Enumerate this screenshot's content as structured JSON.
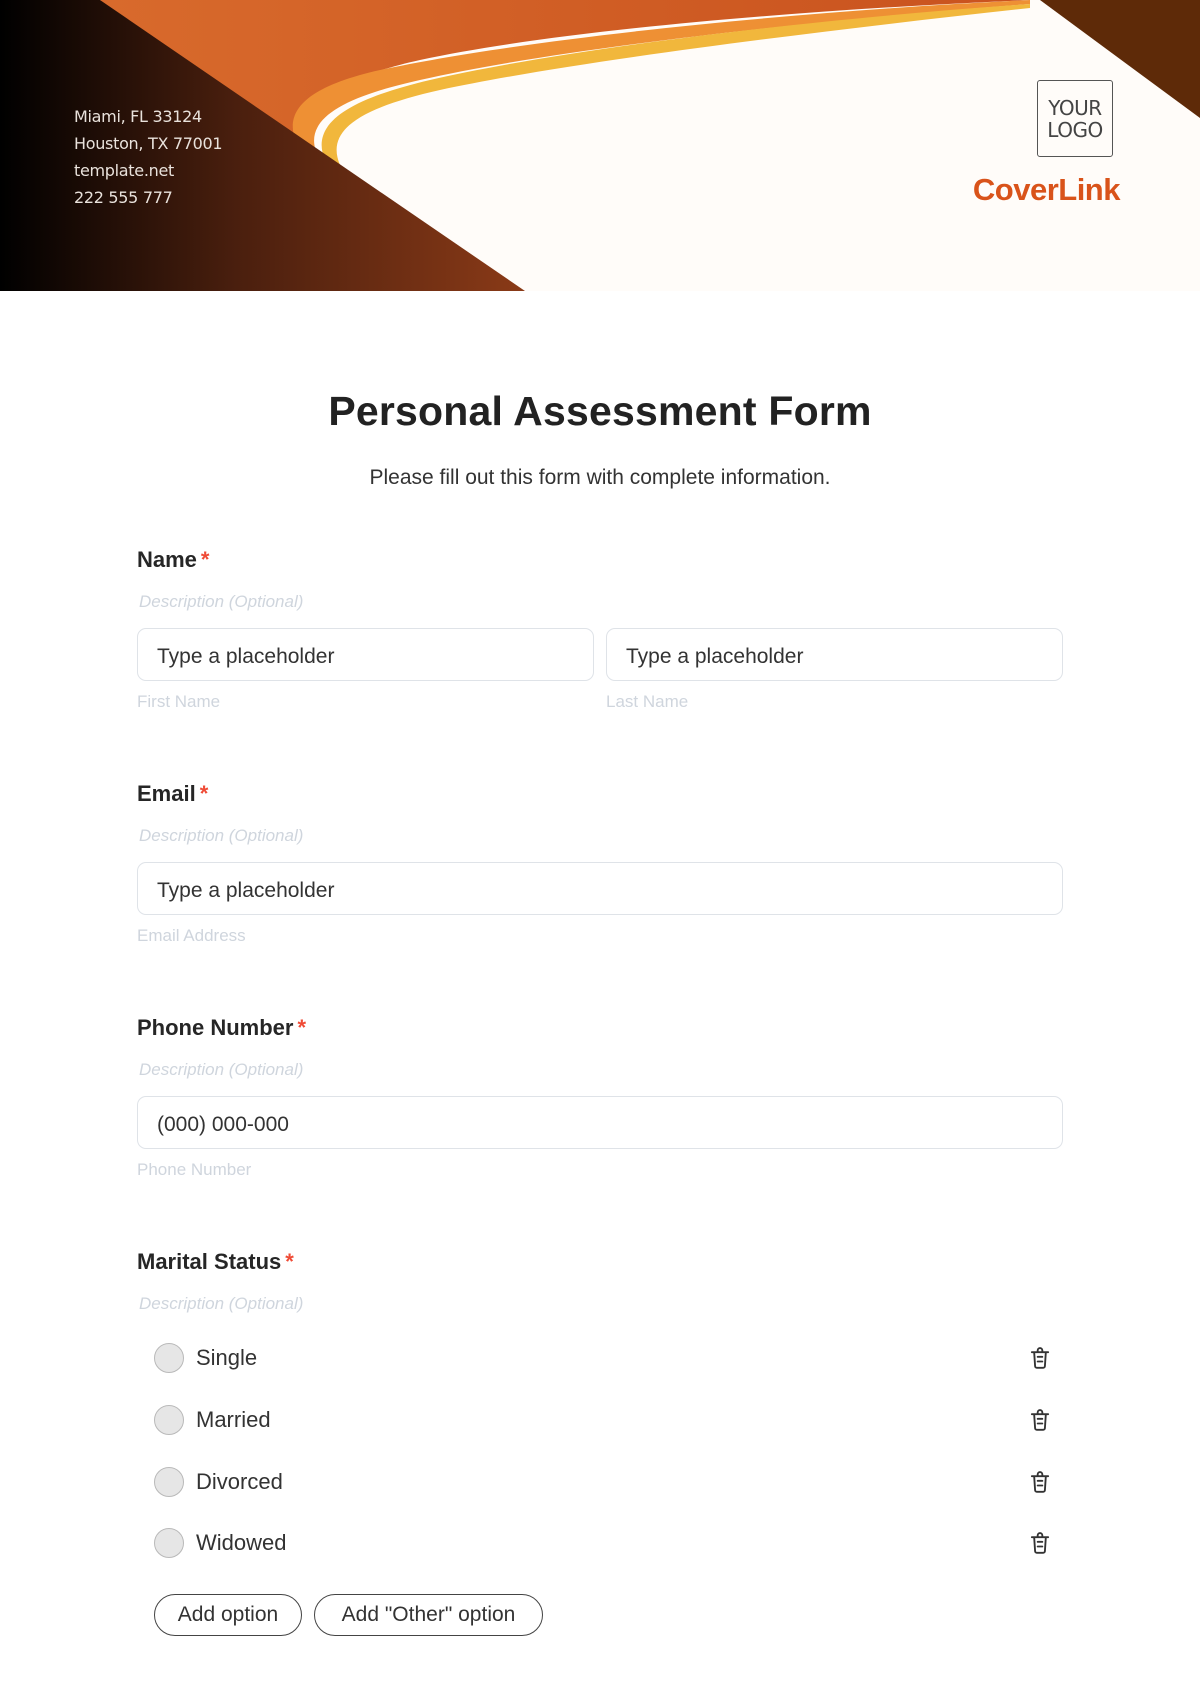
{
  "header": {
    "contact_lines": [
      "Miami, FL 33124",
      "Houston, TX 77001",
      "template.net",
      "222 555 777"
    ],
    "logo_line1": "YOUR",
    "logo_line2": "LOGO",
    "brand_name": "CoverLink",
    "colors": {
      "brand": "#d9531a",
      "dark": "#5c2a0b",
      "orange": "#d4632a",
      "amber": "#f0b43a"
    }
  },
  "form": {
    "title": "Personal Assessment Form",
    "subtitle": "Please fill out this form with complete information.",
    "required_mark": "*",
    "description_placeholder": "Description (Optional)",
    "fields": {
      "name": {
        "label": "Name",
        "first": {
          "placeholder": "Type a placeholder",
          "sublabel": "First Name"
        },
        "last": {
          "placeholder": "Type a placeholder",
          "sublabel": "Last Name"
        }
      },
      "email": {
        "label": "Email",
        "placeholder": "Type a placeholder",
        "sublabel": "Email Address"
      },
      "phone": {
        "label": "Phone Number",
        "placeholder": "(000) 000-000",
        "sublabel": "Phone Number"
      },
      "marital": {
        "label": "Marital Status",
        "options": [
          {
            "label": "Single",
            "icon": "trash-icon"
          },
          {
            "label": "Married",
            "icon": "trash-icon"
          },
          {
            "label": "Divorced",
            "icon": "trash-icon"
          },
          {
            "label": "Widowed",
            "icon": "trash-icon"
          }
        ],
        "add_option": "Add option",
        "add_other_option": "Add \"Other\" option"
      }
    }
  }
}
